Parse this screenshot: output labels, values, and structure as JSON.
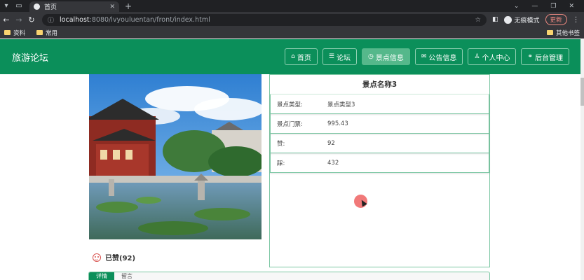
{
  "browser": {
    "tab_title": "首页",
    "url_host": "localhost",
    "url_path": ":8080/lvyouluentan/front/index.html",
    "incognito_label": "无痕模式",
    "update_label": "更新",
    "bookmarks": [
      "资料",
      "常用"
    ],
    "other_bookmarks": "其他书签"
  },
  "header": {
    "brand": "旅游论坛",
    "nav": [
      {
        "label": "首页",
        "icon": "home-icon"
      },
      {
        "label": "论坛",
        "icon": "forum-icon"
      },
      {
        "label": "景点信息",
        "icon": "clock-icon",
        "active": true
      },
      {
        "label": "公告信息",
        "icon": "mail-icon"
      },
      {
        "label": "个人中心",
        "icon": "user-icon"
      },
      {
        "label": "后台管理",
        "icon": "link-icon"
      }
    ]
  },
  "detail": {
    "title": "景点名称3",
    "rows": [
      {
        "label": "景点类型:",
        "value": "景点类型3"
      },
      {
        "label": "景点门票:",
        "value": "995.43"
      },
      {
        "label": "赞:",
        "value": "92"
      },
      {
        "label": "踩:",
        "value": "432"
      }
    ],
    "like_status": "已赞(92)"
  },
  "bottom_tabs": [
    "详情",
    "留言"
  ],
  "colors": {
    "brand_green": "#0b8f5a",
    "active_nav": "#55b88b",
    "border_green": "#7cc7a3"
  }
}
